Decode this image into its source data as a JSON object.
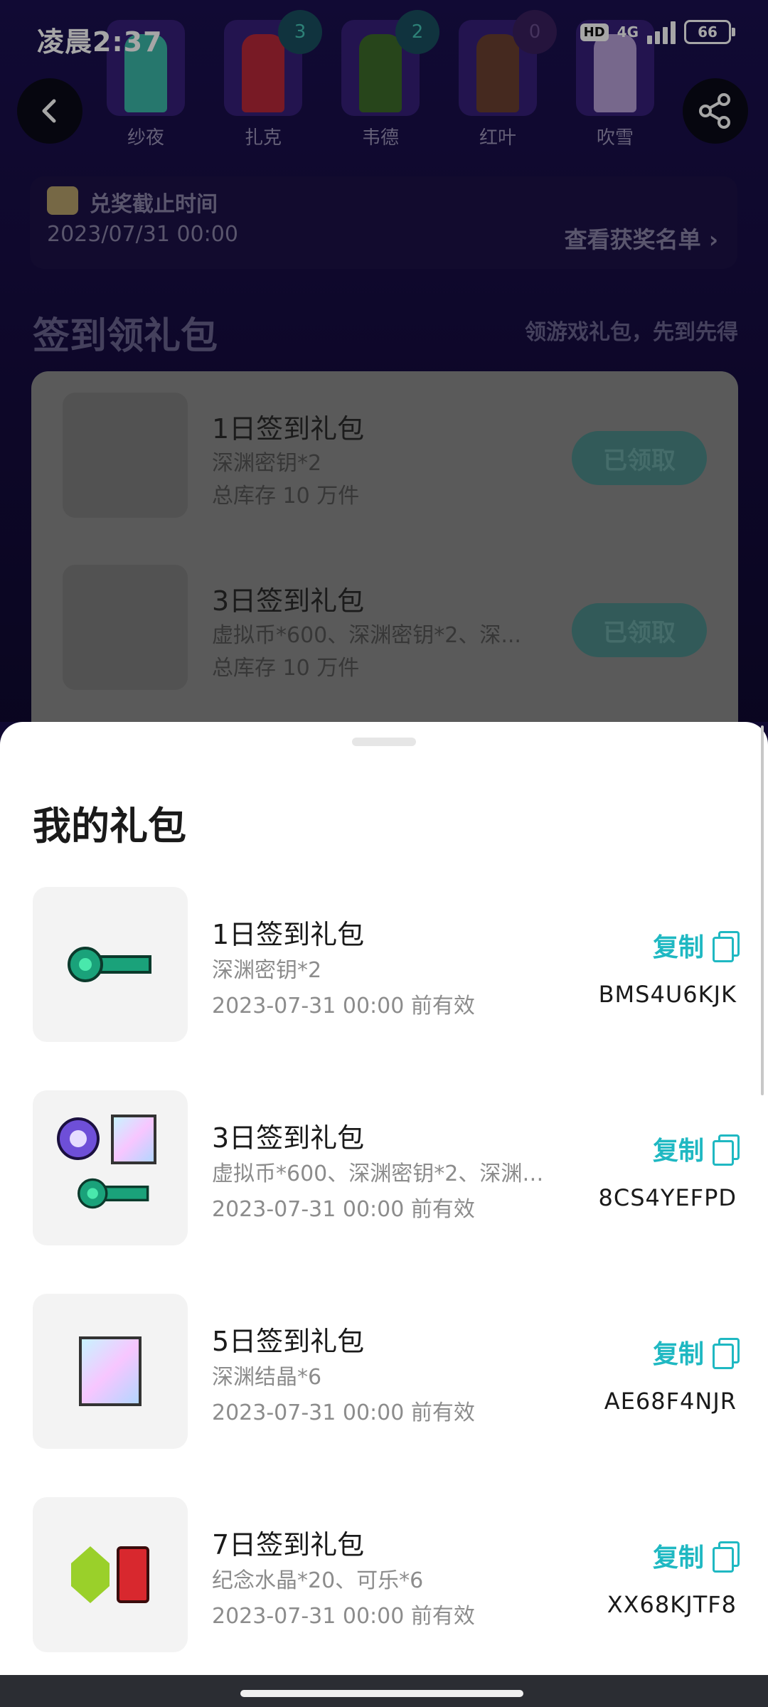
{
  "status_bar": {
    "time": "凌晨2:37",
    "network": "4G",
    "hd": "HD",
    "battery": "66"
  },
  "characters": [
    {
      "name": "纱夜",
      "badge": "",
      "color": "#3bb7a8"
    },
    {
      "name": "扎克",
      "badge": "3",
      "color": "#b8283a"
    },
    {
      "name": "韦德",
      "badge": "2",
      "color": "#3d6a2a"
    },
    {
      "name": "红叶",
      "badge": "0",
      "color": "#6a4030"
    },
    {
      "name": "吹雪",
      "badge": "",
      "color": "#b7a0d8"
    }
  ],
  "deadline": {
    "title": "兑奖截止时间",
    "date": "2023/07/31 00:00",
    "winners_link": "查看获奖名单"
  },
  "signin_section": {
    "title": "签到领礼包",
    "subtitle": "领游戏礼包，先到先得",
    "items": [
      {
        "title": "1日签到礼包",
        "desc": "深渊密钥*2",
        "stock": "总库存 10 万件",
        "button": "已领取"
      },
      {
        "title": "3日签到礼包",
        "desc": "虚拟币*600、深渊密钥*2、深...",
        "stock": "总库存 10 万件",
        "button": "已领取"
      }
    ]
  },
  "sheet": {
    "title": "我的礼包",
    "copy_label": "复制",
    "gifts": [
      {
        "title": "1日签到礼包",
        "desc": "深渊密钥*2",
        "valid": "2023-07-31 00:00 前有效",
        "code": "BMS4U6KJK",
        "icon": "key-icon"
      },
      {
        "title": "3日签到礼包",
        "desc": "虚拟币*600、深渊密钥*2、深渊…",
        "valid": "2023-07-31 00:00 前有效",
        "code": "8CS4YEFPD",
        "icon": "coin-crystal-key-icon"
      },
      {
        "title": "5日签到礼包",
        "desc": "深渊结晶*6",
        "valid": "2023-07-31 00:00 前有效",
        "code": "AE68F4NJR",
        "icon": "crystal-icon"
      },
      {
        "title": "7日签到礼包",
        "desc": "纪念水晶*20、可乐*6",
        "valid": "2023-07-31 00:00 前有效",
        "code": "XX68KJTF8",
        "icon": "gem-cola-icon"
      }
    ]
  },
  "colors": {
    "accent": "#1fb8c2",
    "background_dark": "#140b3c"
  }
}
